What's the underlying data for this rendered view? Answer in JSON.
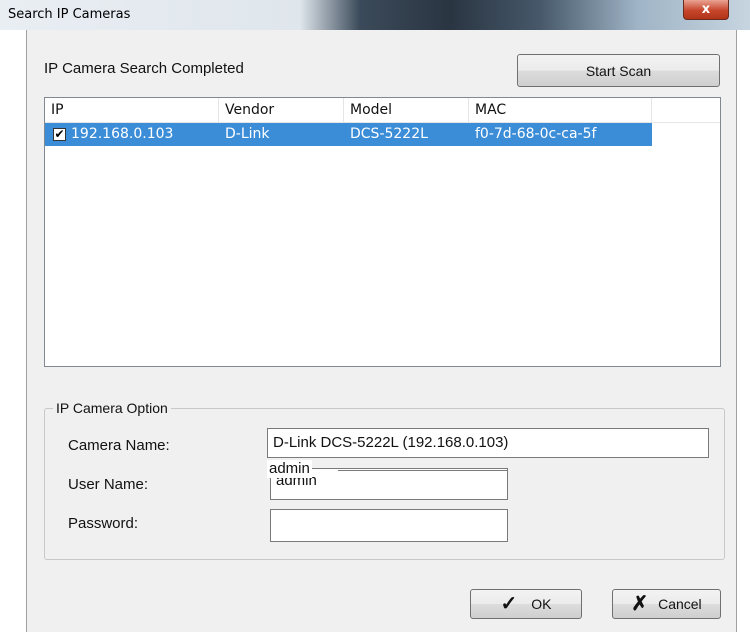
{
  "window": {
    "title": "Search IP Cameras",
    "close_glyph": "x"
  },
  "search": {
    "status": "IP Camera Search Completed",
    "start_scan_label": "Start Scan"
  },
  "table": {
    "columns": [
      "IP",
      "Vendor",
      "Model",
      "MAC"
    ],
    "rows": [
      {
        "checked": true,
        "checkmark": "✔",
        "ip": "192.168.0.103",
        "vendor": "D-Link",
        "model": "DCS-5222L",
        "mac": "f0-7d-68-0c-ca-5f",
        "selected": true
      }
    ]
  },
  "option": {
    "group_title": "IP Camera Option",
    "camera_name_label": "Camera Name:",
    "camera_name_value": "D-Link DCS-5222L (192.168.0.103)",
    "user_name_label": "User Name:",
    "user_name_value": "admin",
    "user_name_overlay": "admin",
    "password_label": "Password:",
    "password_value": ""
  },
  "footer": {
    "ok_label": "OK",
    "ok_icon": "✓",
    "cancel_label": "Cancel",
    "cancel_icon": "✗"
  },
  "colors": {
    "selection": "#3c8dd8",
    "close_button": "#c7462c"
  }
}
